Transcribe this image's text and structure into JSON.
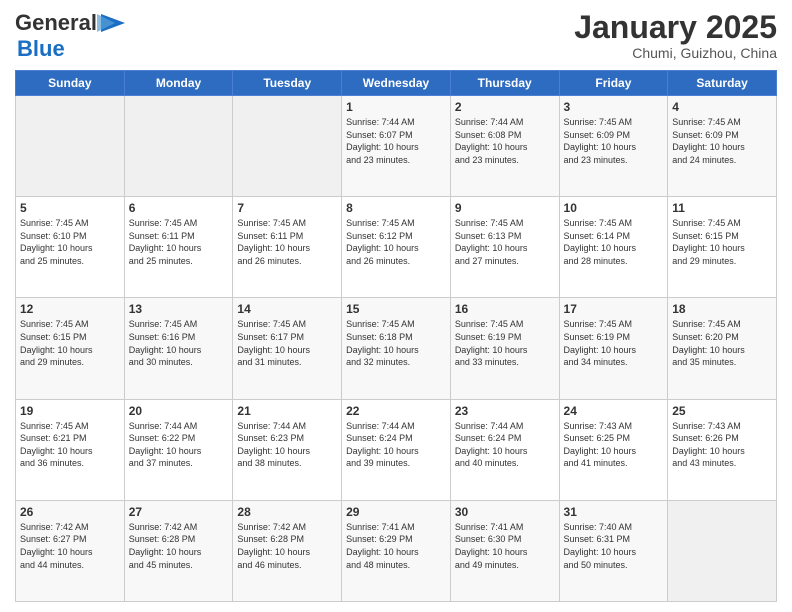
{
  "header": {
    "logo_general": "General",
    "logo_blue": "Blue",
    "month_title": "January 2025",
    "location": "Chumi, Guizhou, China"
  },
  "days_of_week": [
    "Sunday",
    "Monday",
    "Tuesday",
    "Wednesday",
    "Thursday",
    "Friday",
    "Saturday"
  ],
  "weeks": [
    [
      {
        "day": "",
        "info": ""
      },
      {
        "day": "",
        "info": ""
      },
      {
        "day": "",
        "info": ""
      },
      {
        "day": "1",
        "info": "Sunrise: 7:44 AM\nSunset: 6:07 PM\nDaylight: 10 hours\nand 23 minutes."
      },
      {
        "day": "2",
        "info": "Sunrise: 7:44 AM\nSunset: 6:08 PM\nDaylight: 10 hours\nand 23 minutes."
      },
      {
        "day": "3",
        "info": "Sunrise: 7:45 AM\nSunset: 6:09 PM\nDaylight: 10 hours\nand 23 minutes."
      },
      {
        "day": "4",
        "info": "Sunrise: 7:45 AM\nSunset: 6:09 PM\nDaylight: 10 hours\nand 24 minutes."
      }
    ],
    [
      {
        "day": "5",
        "info": "Sunrise: 7:45 AM\nSunset: 6:10 PM\nDaylight: 10 hours\nand 25 minutes."
      },
      {
        "day": "6",
        "info": "Sunrise: 7:45 AM\nSunset: 6:11 PM\nDaylight: 10 hours\nand 25 minutes."
      },
      {
        "day": "7",
        "info": "Sunrise: 7:45 AM\nSunset: 6:11 PM\nDaylight: 10 hours\nand 26 minutes."
      },
      {
        "day": "8",
        "info": "Sunrise: 7:45 AM\nSunset: 6:12 PM\nDaylight: 10 hours\nand 26 minutes."
      },
      {
        "day": "9",
        "info": "Sunrise: 7:45 AM\nSunset: 6:13 PM\nDaylight: 10 hours\nand 27 minutes."
      },
      {
        "day": "10",
        "info": "Sunrise: 7:45 AM\nSunset: 6:14 PM\nDaylight: 10 hours\nand 28 minutes."
      },
      {
        "day": "11",
        "info": "Sunrise: 7:45 AM\nSunset: 6:15 PM\nDaylight: 10 hours\nand 29 minutes."
      }
    ],
    [
      {
        "day": "12",
        "info": "Sunrise: 7:45 AM\nSunset: 6:15 PM\nDaylight: 10 hours\nand 29 minutes."
      },
      {
        "day": "13",
        "info": "Sunrise: 7:45 AM\nSunset: 6:16 PM\nDaylight: 10 hours\nand 30 minutes."
      },
      {
        "day": "14",
        "info": "Sunrise: 7:45 AM\nSunset: 6:17 PM\nDaylight: 10 hours\nand 31 minutes."
      },
      {
        "day": "15",
        "info": "Sunrise: 7:45 AM\nSunset: 6:18 PM\nDaylight: 10 hours\nand 32 minutes."
      },
      {
        "day": "16",
        "info": "Sunrise: 7:45 AM\nSunset: 6:19 PM\nDaylight: 10 hours\nand 33 minutes."
      },
      {
        "day": "17",
        "info": "Sunrise: 7:45 AM\nSunset: 6:19 PM\nDaylight: 10 hours\nand 34 minutes."
      },
      {
        "day": "18",
        "info": "Sunrise: 7:45 AM\nSunset: 6:20 PM\nDaylight: 10 hours\nand 35 minutes."
      }
    ],
    [
      {
        "day": "19",
        "info": "Sunrise: 7:45 AM\nSunset: 6:21 PM\nDaylight: 10 hours\nand 36 minutes."
      },
      {
        "day": "20",
        "info": "Sunrise: 7:44 AM\nSunset: 6:22 PM\nDaylight: 10 hours\nand 37 minutes."
      },
      {
        "day": "21",
        "info": "Sunrise: 7:44 AM\nSunset: 6:23 PM\nDaylight: 10 hours\nand 38 minutes."
      },
      {
        "day": "22",
        "info": "Sunrise: 7:44 AM\nSunset: 6:24 PM\nDaylight: 10 hours\nand 39 minutes."
      },
      {
        "day": "23",
        "info": "Sunrise: 7:44 AM\nSunset: 6:24 PM\nDaylight: 10 hours\nand 40 minutes."
      },
      {
        "day": "24",
        "info": "Sunrise: 7:43 AM\nSunset: 6:25 PM\nDaylight: 10 hours\nand 41 minutes."
      },
      {
        "day": "25",
        "info": "Sunrise: 7:43 AM\nSunset: 6:26 PM\nDaylight: 10 hours\nand 43 minutes."
      }
    ],
    [
      {
        "day": "26",
        "info": "Sunrise: 7:42 AM\nSunset: 6:27 PM\nDaylight: 10 hours\nand 44 minutes."
      },
      {
        "day": "27",
        "info": "Sunrise: 7:42 AM\nSunset: 6:28 PM\nDaylight: 10 hours\nand 45 minutes."
      },
      {
        "day": "28",
        "info": "Sunrise: 7:42 AM\nSunset: 6:28 PM\nDaylight: 10 hours\nand 46 minutes."
      },
      {
        "day": "29",
        "info": "Sunrise: 7:41 AM\nSunset: 6:29 PM\nDaylight: 10 hours\nand 48 minutes."
      },
      {
        "day": "30",
        "info": "Sunrise: 7:41 AM\nSunset: 6:30 PM\nDaylight: 10 hours\nand 49 minutes."
      },
      {
        "day": "31",
        "info": "Sunrise: 7:40 AM\nSunset: 6:31 PM\nDaylight: 10 hours\nand 50 minutes."
      },
      {
        "day": "",
        "info": ""
      }
    ]
  ]
}
